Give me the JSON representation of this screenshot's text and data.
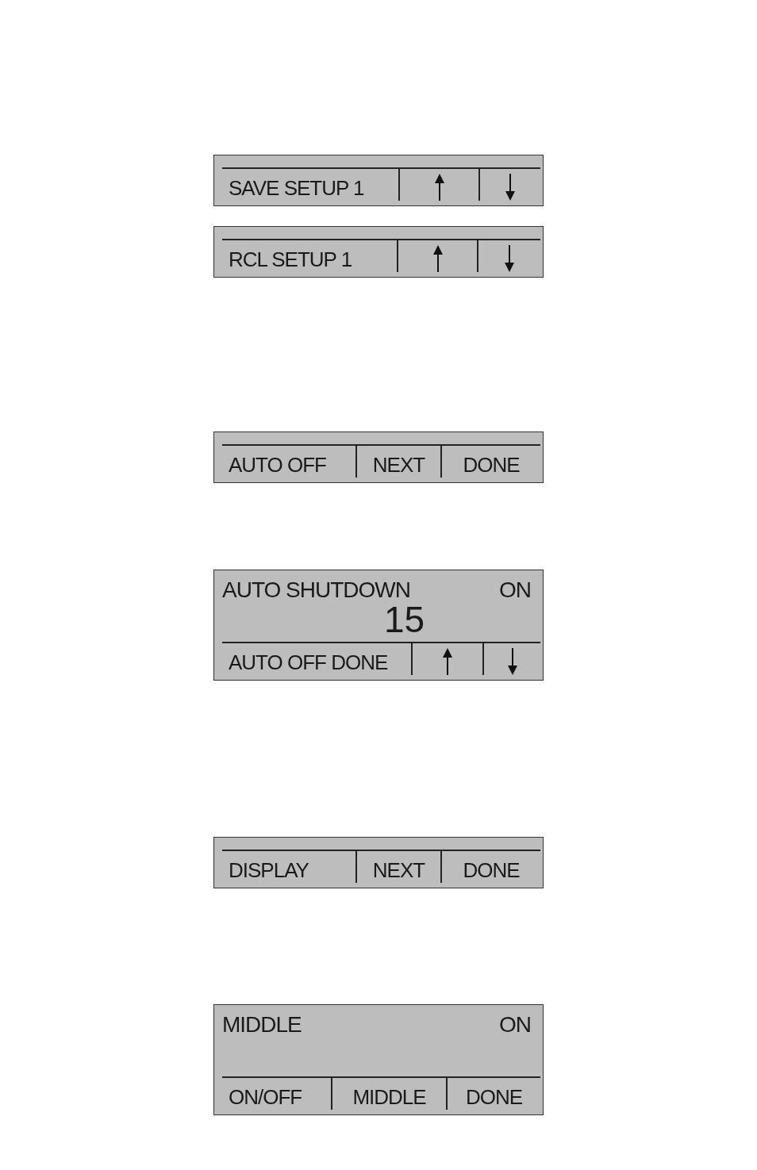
{
  "screens": [
    {
      "softkeys": [
        {
          "kind": "text",
          "label": "SAVE SETUP 1"
        },
        {
          "kind": "up"
        },
        {
          "kind": "down"
        }
      ]
    },
    {
      "softkeys": [
        {
          "kind": "text",
          "label": "RCL SETUP 1"
        },
        {
          "kind": "up"
        },
        {
          "kind": "down"
        }
      ]
    },
    {
      "softkeys": [
        {
          "kind": "text",
          "label": "AUTO OFF"
        },
        {
          "kind": "text",
          "label": "NEXT"
        },
        {
          "kind": "text",
          "label": "DONE"
        }
      ]
    },
    {
      "header": {
        "label": "AUTO SHUTDOWN",
        "value": "ON",
        "number": "15"
      },
      "softkeys": [
        {
          "kind": "text",
          "label": "AUTO OFF DONE"
        },
        {
          "kind": "up"
        },
        {
          "kind": "down"
        }
      ]
    },
    {
      "softkeys": [
        {
          "kind": "text",
          "label": "DISPLAY"
        },
        {
          "kind": "text",
          "label": "NEXT"
        },
        {
          "kind": "text",
          "label": "DONE"
        }
      ]
    },
    {
      "header": {
        "label": "MIDDLE",
        "value": "ON"
      },
      "softkeys": [
        {
          "kind": "text",
          "label": "ON/OFF"
        },
        {
          "kind": "text",
          "label": "MIDDLE"
        },
        {
          "kind": "text",
          "label": "DONE"
        }
      ]
    }
  ]
}
